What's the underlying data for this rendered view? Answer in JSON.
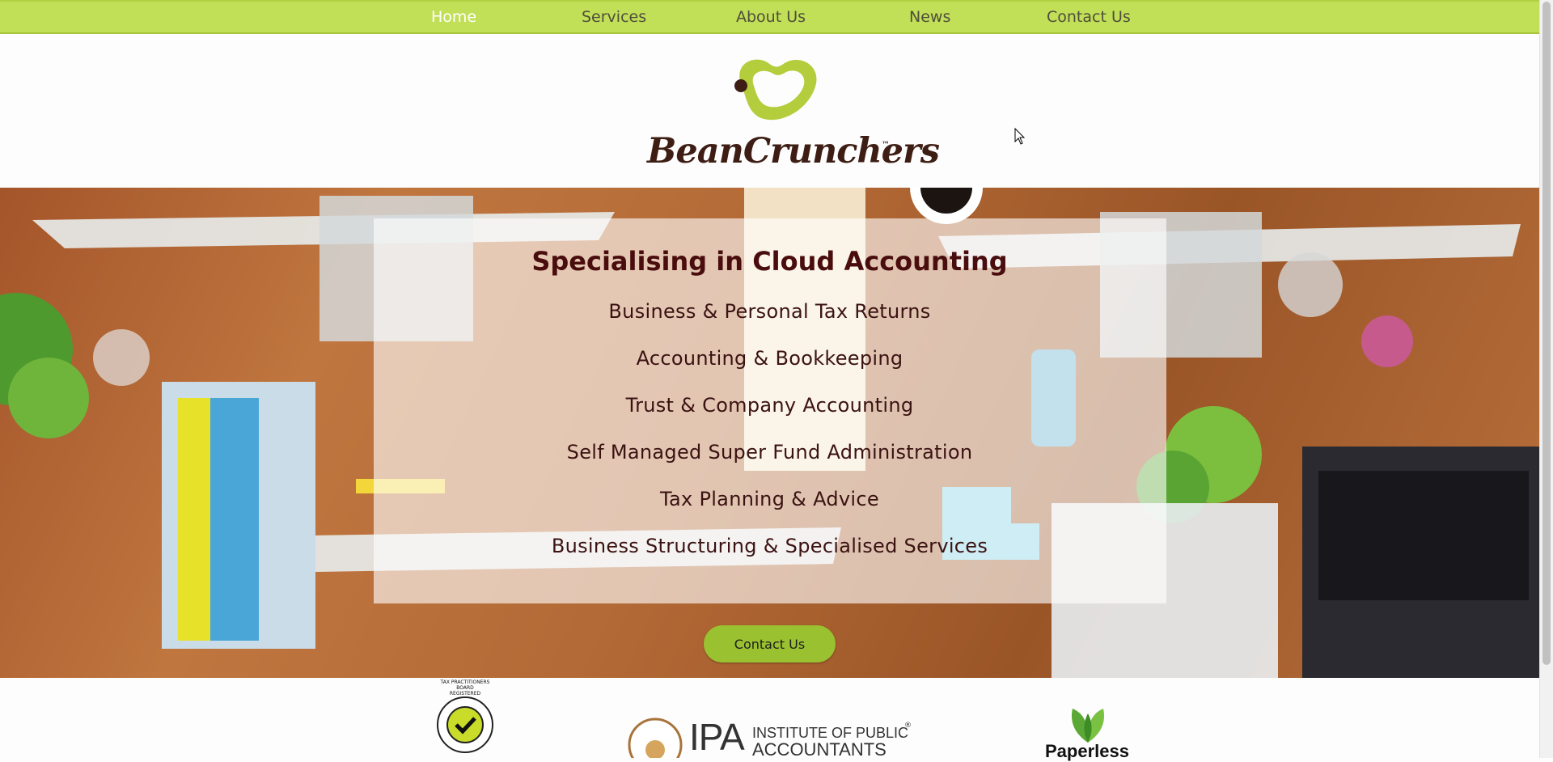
{
  "nav": {
    "items": [
      {
        "label": "Home",
        "active": true
      },
      {
        "label": "Services",
        "active": false
      },
      {
        "label": "About Us",
        "active": false
      },
      {
        "label": "News",
        "active": false
      },
      {
        "label": "Contact Us",
        "active": false
      }
    ]
  },
  "header": {
    "logo_text": "BeanCrunchers",
    "logo_tm": "™",
    "logo_icon": "bean-icon"
  },
  "hero": {
    "title": "Specialising in Cloud Accounting",
    "services": [
      "Business & Personal Tax Returns",
      "Accounting & Bookkeeping",
      "Trust & Company Accounting",
      "Self Managed Super Fund Administration",
      "Tax Planning & Advice",
      "Business Structuring & Specialised Services"
    ],
    "cta_label": "Contact Us"
  },
  "badges": {
    "tpb": {
      "icon": "tax-practitioners-board-icon",
      "label": "TAX PRACTITIONERS BOARD",
      "sub": "REGISTERED"
    },
    "ipa": {
      "big": "IPA",
      "line1": "INSTITUTE OF PUBLIC",
      "line2": "ACCOUNTANTS",
      "mark": "®"
    },
    "paperless": {
      "label": "Paperless",
      "icon": "leaf-icon"
    }
  },
  "colors": {
    "nav_bg": "#c2df58",
    "brand_green": "#b4cd3c",
    "brand_brown": "#3e1e14",
    "cta_bg": "#9ac130",
    "title_color": "#4a0d0d"
  }
}
